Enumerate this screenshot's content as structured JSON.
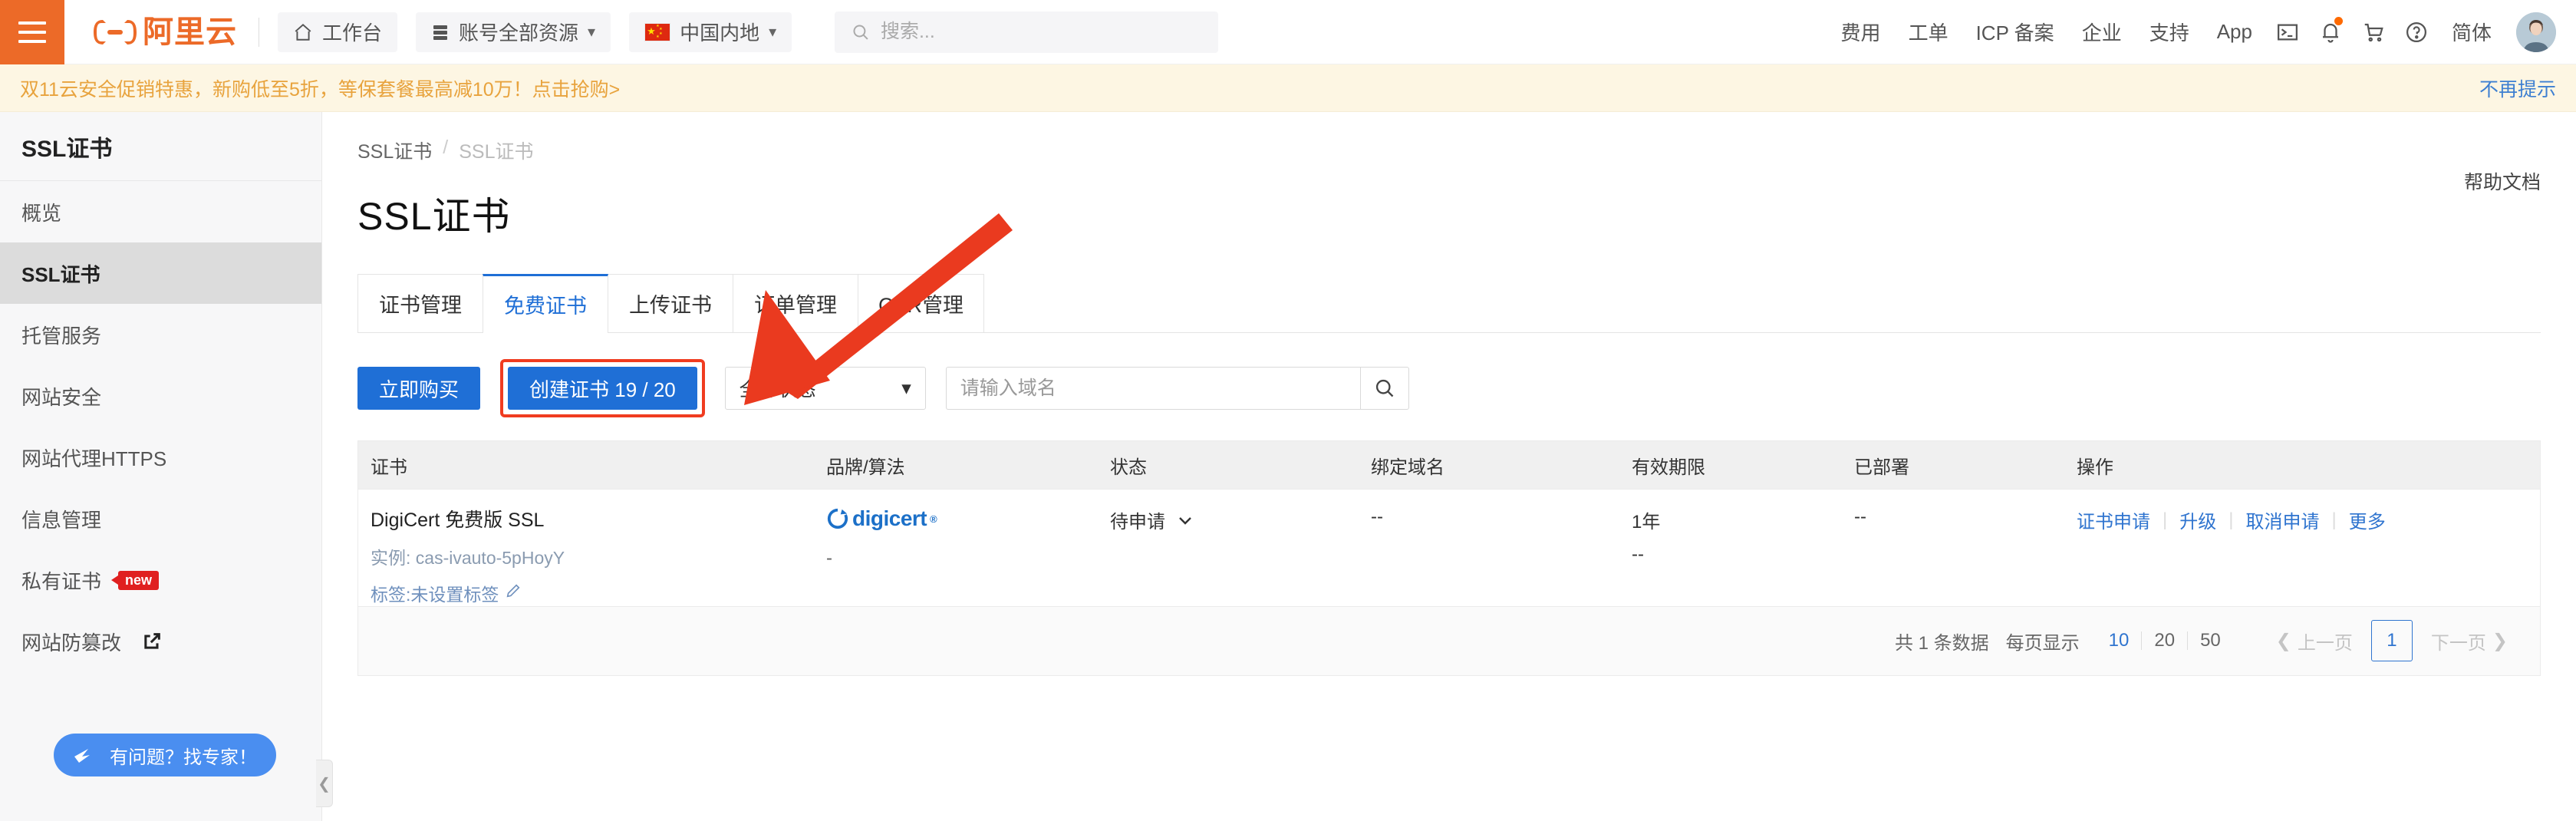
{
  "header": {
    "menu_icon": "hamburger-icon",
    "brand": "阿里云",
    "workbench": "工作台",
    "resources": "账号全部资源",
    "region": "中国内地",
    "search_placeholder": "搜索...",
    "search_value": "",
    "links": [
      "费用",
      "工单",
      "ICP 备案",
      "企业",
      "支持",
      "App"
    ],
    "icons": [
      "terminal-icon",
      "bell-icon",
      "cart-icon",
      "help-circle-icon"
    ],
    "language": "简体",
    "avatar": "user-avatar"
  },
  "promo": {
    "text": "双11云安全促销特惠，新购低至5折，等保套餐最高减10万！点击抢购>",
    "dismiss": "不再提示"
  },
  "sidebar": {
    "title": "SSL证书",
    "items": [
      {
        "label": "概览",
        "active": false,
        "badge": "",
        "external": false
      },
      {
        "label": "SSL证书",
        "active": true,
        "badge": "",
        "external": false
      },
      {
        "label": "托管服务",
        "active": false,
        "badge": "",
        "external": false
      },
      {
        "label": "网站安全",
        "active": false,
        "badge": "",
        "external": false
      },
      {
        "label": "网站代理HTTPS",
        "active": false,
        "badge": "",
        "external": false
      },
      {
        "label": "信息管理",
        "active": false,
        "badge": "",
        "external": false
      },
      {
        "label": "私有证书",
        "active": false,
        "badge": "new",
        "external": false
      },
      {
        "label": "网站防篡改",
        "active": false,
        "badge": "",
        "external": true
      }
    ],
    "expert_button": "有问题？找专家！",
    "collapse_icon": "chevron-left-icon"
  },
  "main": {
    "breadcrumb": [
      "SSL证书",
      "SSL证书"
    ],
    "breadcrumb_separator": "/",
    "help_doc": "帮助文档",
    "page_title": "SSL证书",
    "tabs": [
      {
        "label": "证书管理",
        "active": false
      },
      {
        "label": "免费证书",
        "active": true
      },
      {
        "label": "上传证书",
        "active": false
      },
      {
        "label": "订单管理",
        "active": false
      },
      {
        "label": "CSR管理",
        "active": false
      }
    ],
    "toolbar": {
      "buy_now": "立即购买",
      "create_cert": "创建证书 19 / 20",
      "status_filter": "全部状态",
      "domain_placeholder": "请输入域名",
      "domain_value": "",
      "search_icon": "search-icon"
    },
    "table": {
      "columns": [
        "证书",
        "品牌/算法",
        "状态",
        "绑定域名",
        "有效期限",
        "已部署",
        "操作"
      ],
      "rows": [
        {
          "cert_name": "DigiCert 免费版 SSL",
          "instance": "实例: cas-ivauto-5pHoyY",
          "tag": "标签:未设置标签",
          "tag_edit_icon": "pencil-icon",
          "brand": "digicert",
          "algorithm": "-",
          "status": "待申请",
          "status_caret": "chevron-down-icon",
          "bound_domain": "--",
          "validity": "1年",
          "validity_sub": "--",
          "deployed": "--",
          "actions": [
            "证书申请",
            "升级",
            "取消申请",
            "更多"
          ]
        }
      ]
    },
    "pagination": {
      "total_text": "共 1 条数据",
      "per_page_label": "每页显示",
      "sizes": [
        "10",
        "20",
        "50"
      ],
      "selected_size": "10",
      "prev": "上一页",
      "next": "下一页",
      "current_page": "1"
    }
  },
  "annotation": {
    "arrow_color": "#ea3a1f",
    "highlight_color": "#f03c20",
    "highlight_target": "创建证书 19 / 20"
  },
  "colors": {
    "brand_orange": "#ec6a28",
    "primary_blue": "#1f6fd6",
    "link_blue": "#2f74cf",
    "promo_bg": "#fdf6e3",
    "promo_text": "#e8a33d",
    "sidebar_bg": "#f7f7f8",
    "active_item_bg": "#dcdcdc"
  }
}
